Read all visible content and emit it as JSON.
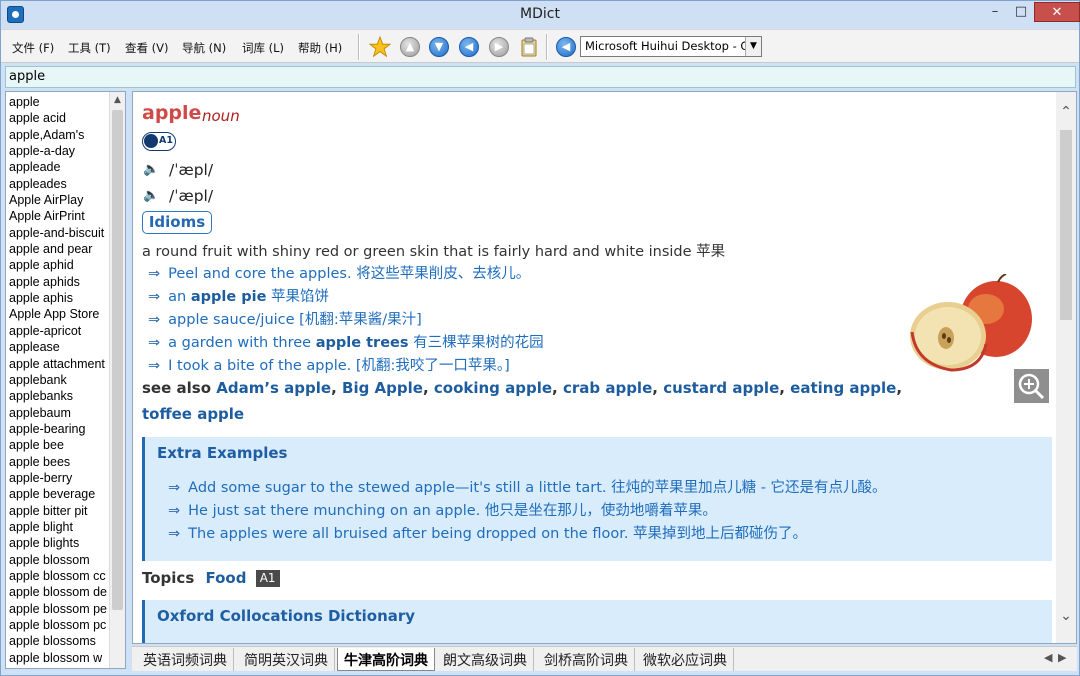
{
  "window": {
    "title": "MDict"
  },
  "menu": [
    {
      "label": "文件 (F)"
    },
    {
      "label": "工具 (T)"
    },
    {
      "label": "查看 (V)"
    },
    {
      "label": "导航 (N)"
    },
    {
      "label": "词库 (L)"
    },
    {
      "label": "帮助 (H)"
    }
  ],
  "toolbar": {
    "font_select": "Microsoft Huihui Desktop - C"
  },
  "search": {
    "value": "apple"
  },
  "wordlist": [
    "apple",
    "apple acid",
    "apple,Adam's",
    "apple-a-day",
    "appleade",
    "appleades",
    "Apple AirPlay",
    "Apple AirPrint",
    "apple-and-biscuit",
    "apple and pear",
    "apple aphid",
    "apple aphids",
    "apple aphis",
    "Apple App Store",
    "apple-apricot",
    "applease",
    "apple attachment",
    "applebank",
    "applebanks",
    "applebaum",
    "apple-bearing",
    "apple bee",
    "apple bees",
    "apple-berry",
    "apple beverage",
    "apple bitter pit",
    "apple blight",
    "apple blights",
    "apple blossom",
    "apple blossom cc",
    "apple blossom de",
    "apple blossom pe",
    "apple blossom pc",
    "apple blossoms",
    "apple blossom w"
  ],
  "entry": {
    "headword": "apple",
    "pos": "noun",
    "level": "A1",
    "pron_uk": "/ˈæpl/",
    "pron_us": "/ˈæpl/",
    "idioms_label": "Idioms",
    "definition": "a round fruit with shiny red or green skin that is fairly hard and white inside 苹果",
    "examples": [
      {
        "pre": "Peel and core the apples. 将这些苹果削皮、去核儿。",
        "bold": "",
        "post": ""
      },
      {
        "pre": "an ",
        "bold": "apple pie",
        "post": " 苹果馅饼"
      },
      {
        "pre": "apple sauce/juice [机翻:苹果酱/果汁]",
        "bold": "",
        "post": ""
      },
      {
        "pre": "a garden with three ",
        "bold": "apple trees",
        "post": " 有三棵苹果树的花园"
      },
      {
        "pre": "I took a bite of the apple. [机翻:我咬了一口苹果。]",
        "bold": "",
        "post": ""
      }
    ],
    "see_also_label": "see also",
    "see_also_line1": [
      {
        "text": "Adam’s apple",
        "sep": ", "
      },
      {
        "text": "Big Apple",
        "sep": ", "
      },
      {
        "text": "cooking apple",
        "sep": ", "
      },
      {
        "text": "crab apple",
        "sep": ", "
      },
      {
        "text": "custard apple",
        "sep": ", "
      },
      {
        "text": "eating apple",
        "sep": ","
      }
    ],
    "see_also_line2": [
      {
        "text": "toffee apple",
        "sep": ""
      }
    ],
    "extra_title": "Extra Examples",
    "extra_examples": [
      "Add some sugar to the stewed apple—it's still a little tart. 往炖的苹果里加点儿糖 - 它还是有点儿酸。",
      "He just sat there munching on an apple. 他只是坐在那儿，使劲地嚼着苹果。",
      "The apples were all bruised after being dropped on the floor. 苹果掉到地上后都碰伤了。"
    ],
    "topics_label": "Topics",
    "topics_value": "Food",
    "topics_level": "A1",
    "colloc_title": "Oxford Collocations Dictionary"
  },
  "tabs": [
    {
      "label": "英语词频词典"
    },
    {
      "label": "简明英汉词典"
    },
    {
      "label": "牛津高阶词典"
    },
    {
      "label": "朗文高级词典"
    },
    {
      "label": "剑桥高阶词典"
    },
    {
      "label": "微软必应词典"
    }
  ],
  "active_tab": "牛津高阶词典",
  "colors": {
    "headword": "#d14a4a",
    "link": "#1d5c9e",
    "example": "#1f6dbd",
    "box_bg": "#d9ecfb"
  }
}
